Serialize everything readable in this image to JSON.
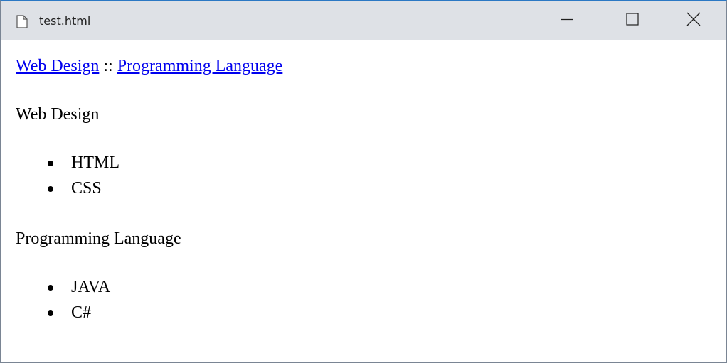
{
  "window": {
    "title": "test.html",
    "icons": {
      "document": "document-icon",
      "minimize": "minimize-icon",
      "maximize": "maximize-icon",
      "close": "close-icon"
    }
  },
  "nav": {
    "link1": "Web Design",
    "separator": "::",
    "link2": "Programming Language"
  },
  "sections": [
    {
      "heading": "Web Design",
      "items": [
        "HTML",
        "CSS"
      ]
    },
    {
      "heading": "Programming Language",
      "items": [
        "JAVA",
        "C#"
      ]
    }
  ],
  "colors": {
    "link": "#0000ee",
    "titlebar": "#dee1e6"
  }
}
